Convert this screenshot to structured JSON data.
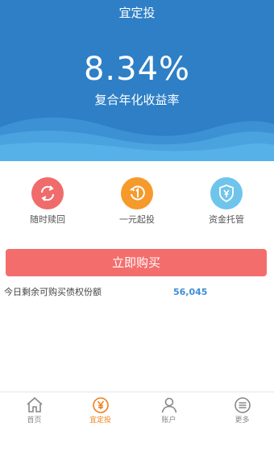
{
  "header": {
    "title": "宜定投",
    "rate": "8.34%",
    "rate_label": "复合年化收益率"
  },
  "features": [
    {
      "label": "随时赎回",
      "icon": "refresh-icon",
      "color": "#f06b6b"
    },
    {
      "label": "一元起投",
      "icon": "one-yuan-icon",
      "color": "#f59a2b"
    },
    {
      "label": "资金托管",
      "icon": "yen-shield-icon",
      "color": "#6fc4ec"
    }
  ],
  "buy_button": {
    "label": "立即购买",
    "color": "#f46d6d"
  },
  "remaining": {
    "label": "今日剩余可购买债权份额",
    "value": "56,045"
  },
  "tabbar": {
    "items": [
      {
        "label": "首页",
        "icon": "home-icon"
      },
      {
        "label": "宜定投",
        "icon": "yen-circle-icon",
        "active": true
      },
      {
        "label": "账户",
        "icon": "user-icon"
      },
      {
        "label": "更多",
        "icon": "menu-icon"
      }
    ]
  },
  "colors": {
    "hero": "#2e7fc6",
    "accent": "#ef7f1a",
    "value": "#3d8ed6"
  }
}
